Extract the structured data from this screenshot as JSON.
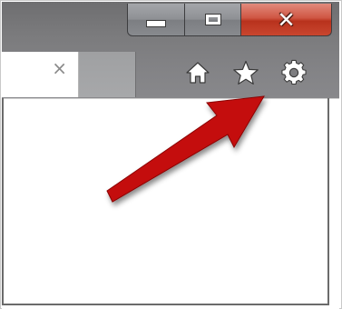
{
  "window": {
    "caption_buttons": {
      "minimize_icon": "minimize-icon",
      "maximize_icon": "maximize-icon",
      "close_icon": "close-icon",
      "close_color": "#c9462f"
    }
  },
  "tab": {
    "close_glyph": "×"
  },
  "toolbar": {
    "icons": [
      "home-icon",
      "favorites-star-icon",
      "settings-gear-icon"
    ]
  },
  "annotation": {
    "arrow_color": "#c40d0d",
    "points_to": "settings-gear-icon"
  }
}
